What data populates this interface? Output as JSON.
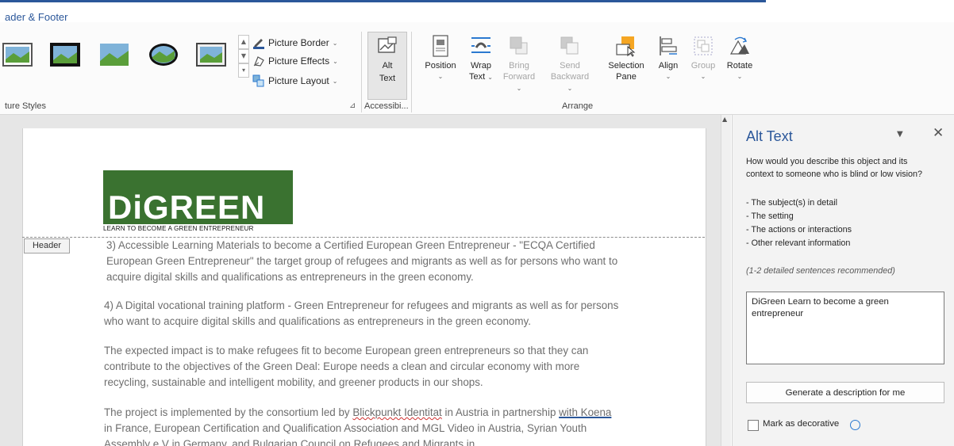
{
  "ribbon": {
    "tab_title": "ader & Footer",
    "picture_border_label": "Picture Border",
    "picture_effects_label": "Picture Effects",
    "picture_layout_label": "Picture Layout",
    "group_picture_styles": "ture Styles",
    "group_accessibility": "Accessibi...",
    "group_arrange": "Arrange",
    "alt_text": [
      "Alt",
      "Text"
    ],
    "position": "Position",
    "wrap_text": [
      "Wrap",
      "Text"
    ],
    "bring_forward": [
      "Bring",
      "Forward"
    ],
    "send_backward": [
      "Send",
      "Backward"
    ],
    "selection_pane": [
      "Selection",
      "Pane"
    ],
    "align": "Align",
    "group": "Group",
    "rotate": "Rotate"
  },
  "document": {
    "logo_text": "DiGREEN",
    "logo_tagline": "LEARN TO BECOME A GREEN ENTREPRENEUR",
    "header_tag": "Header",
    "p1": "3) Accessible Learning Materials to become a Certified European Green Entrepreneur - \"ECQA Certified European Green Entrepreneur\" the target group of refugees and migrants as well as for persons who want to acquire digital skills and qualifications as entrepreneurs in the green economy.",
    "p2": "4) A Digital vocational training platform - Green Entrepreneur for refugees and migrants as well as for persons who want to acquire digital skills and qualifications as entrepreneurs in the green economy.",
    "p3": "The expected impact is to make refugees fit to become European green entrepreneurs so that they can contribute to the objectives of the Green Deal: Europe needs a clean and circular economy with more recycling, sustainable and intelligent mobility, and greener products in our shops.",
    "p4_a": "The project is implemented by the consortium led by ",
    "p4_b": "Blickpunkt Identitat",
    "p4_c": " in Austria in partnership ",
    "p4_d": "with Koena",
    "p4_e": " in France, European Certification and Qualification Association and MGL Video in Austria, Syrian Youth Assembly e.V in Germany, and Bulgarian Council on Refugees and Migrants in"
  },
  "pane": {
    "title": "Alt Text",
    "question": "How would you describe this object and its context to someone who is blind or low vision?",
    "bullets": [
      "- The subject(s) in detail",
      "- The setting",
      "- The actions or interactions",
      "- Other relevant information"
    ],
    "recommend": "(1-2 detailed sentences recommended)",
    "alt_value": "DiGreen Learn to become a green entrepreneur",
    "generate_label": "Generate a description for me",
    "decorative_label": "Mark as decorative"
  },
  "colors": {
    "accent": "#2b579a",
    "logo_green": "#3a7230",
    "selection_orange": "#f5a623"
  }
}
